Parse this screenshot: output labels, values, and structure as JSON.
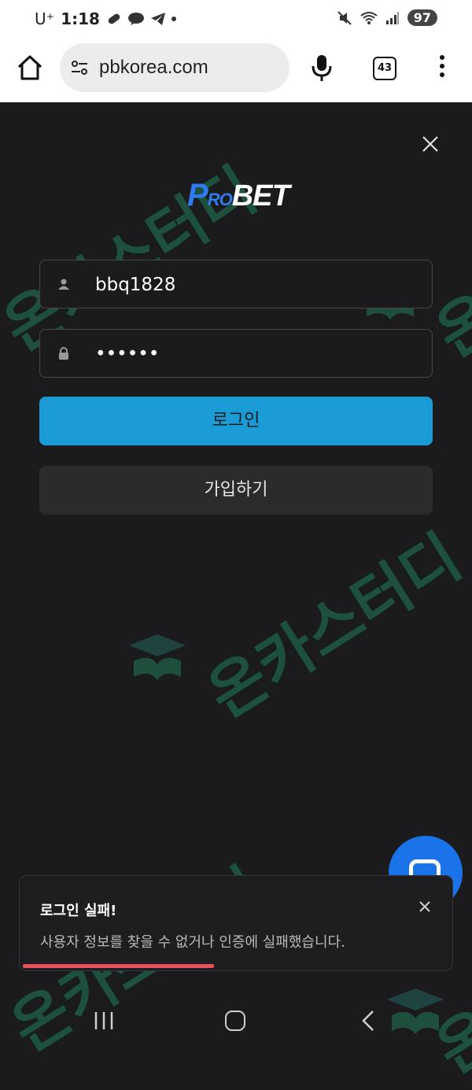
{
  "status_bar": {
    "carrier": "U⁺",
    "time": "1:18",
    "battery": "97"
  },
  "browser": {
    "url": "pbkorea.com",
    "tab_count": "43"
  },
  "login": {
    "username_value": "bbq1828",
    "password_value": "••••••",
    "login_label": "로그인",
    "signup_label": "가입하기"
  },
  "watermark": {
    "text": "온카스터디"
  },
  "toast": {
    "title": "로그인 실패!",
    "message": "사용자 정보를 찾을 수 없거나 인증에 실패했습니다.",
    "progress_remaining": 0.45
  },
  "colors": {
    "login_button": "#1a9bd6",
    "progress_bar": "#e8505b",
    "chat_button": "#1a73e8",
    "brand_blue": "#2f7bf0"
  }
}
